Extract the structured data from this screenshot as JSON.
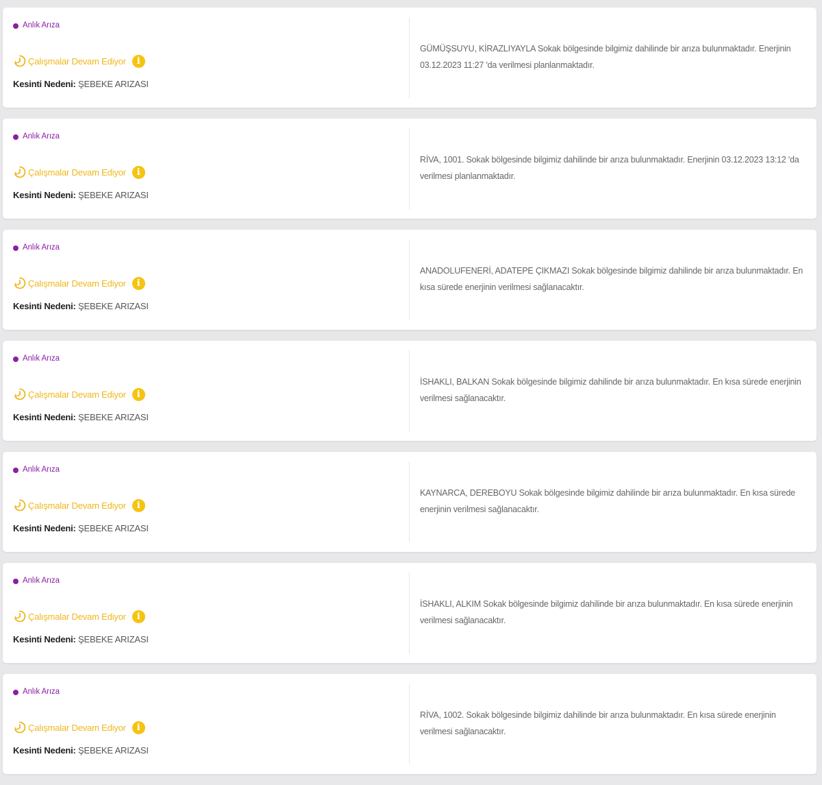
{
  "colors": {
    "accent_purple": "#8a1fa5",
    "status_yellow": "#f0b61a",
    "info_yellow": "#f5c412",
    "background": "#e8e8eb"
  },
  "outages": [
    {
      "type_label": "Anlık Arıza",
      "status_label": "Çalışmalar Devam Ediyor",
      "info_glyph": "i",
      "reason_key": "Kesinti Nedeni:",
      "reason_value": "ŞEBEKE ARIZASI",
      "message": "GÜMÜŞSUYU, KİRAZLIYAYLA Sokak bölgesinde bilgimiz dahilinde bir arıza bulunmaktadır. Enerjinin 03.12.2023 11:27 'da verilmesi planlanmaktadır."
    },
    {
      "type_label": "Anlık Arıza",
      "status_label": "Çalışmalar Devam Ediyor",
      "info_glyph": "i",
      "reason_key": "Kesinti Nedeni:",
      "reason_value": "ŞEBEKE ARIZASI",
      "message": "RİVA, 1001. Sokak bölgesinde bilgimiz dahilinde bir arıza bulunmaktadır. Enerjinin 03.12.2023 13:12 'da verilmesi planlanmaktadır."
    },
    {
      "type_label": "Anlık Arıza",
      "status_label": "Çalışmalar Devam Ediyor",
      "info_glyph": "i",
      "reason_key": "Kesinti Nedeni:",
      "reason_value": "ŞEBEKE ARIZASI",
      "message": "ANADOLUFENERİ, ADATEPE ÇIKMAZI Sokak bölgesinde bilgimiz dahilinde bir arıza bulunmaktadır. En kısa sürede enerjinin verilmesi sağlanacaktır."
    },
    {
      "type_label": "Anlık Arıza",
      "status_label": "Çalışmalar Devam Ediyor",
      "info_glyph": "i",
      "reason_key": "Kesinti Nedeni:",
      "reason_value": "ŞEBEKE ARIZASI",
      "message": "İSHAKLI, BALKAN Sokak bölgesinde bilgimiz dahilinde bir arıza bulunmaktadır. En kısa sürede enerjinin verilmesi sağlanacaktır."
    },
    {
      "type_label": "Anlık Arıza",
      "status_label": "Çalışmalar Devam Ediyor",
      "info_glyph": "i",
      "reason_key": "Kesinti Nedeni:",
      "reason_value": "ŞEBEKE ARIZASI",
      "message": "KAYNARCA, DEREBOYU Sokak bölgesinde bilgimiz dahilinde bir arıza bulunmaktadır. En kısa sürede enerjinin verilmesi sağlanacaktır."
    },
    {
      "type_label": "Anlık Arıza",
      "status_label": "Çalışmalar Devam Ediyor",
      "info_glyph": "i",
      "reason_key": "Kesinti Nedeni:",
      "reason_value": "ŞEBEKE ARIZASI",
      "message": "İSHAKLI, ALKIM Sokak bölgesinde bilgimiz dahilinde bir arıza bulunmaktadır. En kısa sürede enerjinin verilmesi sağlanacaktır."
    },
    {
      "type_label": "Anlık Arıza",
      "status_label": "Çalışmalar Devam Ediyor",
      "info_glyph": "i",
      "reason_key": "Kesinti Nedeni:",
      "reason_value": "ŞEBEKE ARIZASI",
      "message": "RİVA, 1002. Sokak bölgesinde bilgimiz dahilinde bir arıza bulunmaktadır. En kısa sürede enerjinin verilmesi sağlanacaktır."
    }
  ]
}
